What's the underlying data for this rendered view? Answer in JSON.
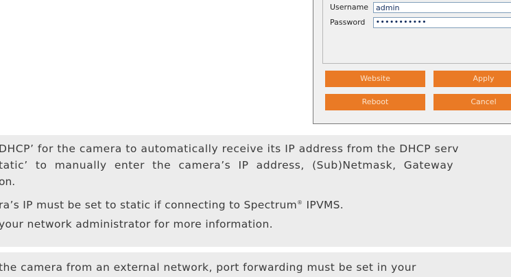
{
  "dialog": {
    "username_label": "Username",
    "username_value": "admin",
    "password_label": "Password",
    "password_value": "•••••••••••",
    "buttons": {
      "website": "Website",
      "apply": "Apply",
      "reboot": "Reboot",
      "cancel": "Cancel"
    },
    "button_color": "#ea7a25"
  },
  "instructions": {
    "lines": [
      "DHCP’ for the camera to automatically receive its IP address from the DHCP serv",
      "tatic’ to manually enter the camera’s IP address, (Sub)Netmask, Gateway",
      "on.",
      "ra’s IP must be set to static if connecting to Spectrum",
      "® IPVMS.",
      "your network administrator for more information."
    ],
    "note": "the camera from an external network, port forwarding must be set in your"
  }
}
